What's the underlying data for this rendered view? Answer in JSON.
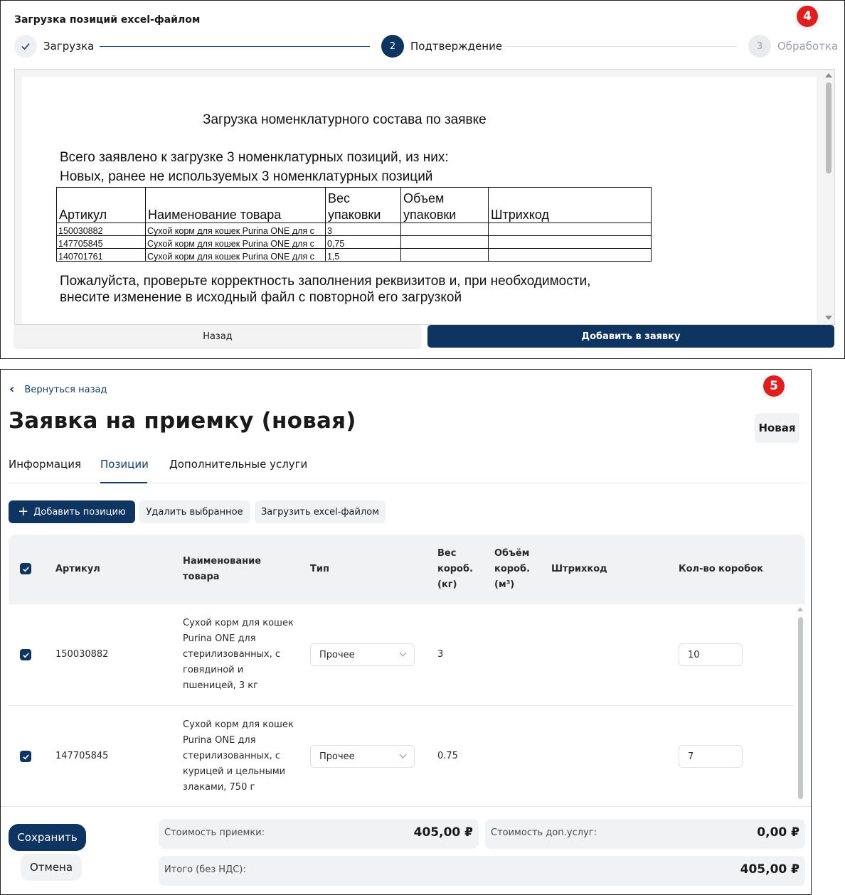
{
  "panel4": {
    "badge": "4",
    "title": "Загрузка позиций excel-файлом",
    "steps": [
      {
        "number": "✓",
        "label": "Загрузка"
      },
      {
        "number": "2",
        "label": "Подтверждение"
      },
      {
        "number": "3",
        "label": "Обработка"
      }
    ],
    "document": {
      "heading": "Загрузка номенклатурного состава по заявке",
      "line1": "Всего заявлено к загрузке 3 номенклатурных позиций, из них:",
      "line2": "Новых, ранее не используемых 3 номенклатурных позиций",
      "headers": [
        "Артикул",
        "Наименование товара",
        "Вес упаковки",
        "Объем упаковки",
        "Штрихкод"
      ],
      "headers_split": {
        "weight_1": "Вес",
        "weight_2": "упаковки",
        "volume_1": "Объем",
        "volume_2": "упаковки"
      },
      "rows": [
        {
          "article": "150030882",
          "name": "Сухой корм для кошек Purina ONE для с",
          "weight": "3",
          "volume": "",
          "barcode": ""
        },
        {
          "article": "147705845",
          "name": "Сухой корм для кошек Purina ONE для с",
          "weight": "0,75",
          "volume": "",
          "barcode": ""
        },
        {
          "article": "140701761",
          "name": "Сухой корм для кошек Purina ONE для с",
          "weight": "1,5",
          "volume": "",
          "barcode": ""
        }
      ],
      "note1": "Пожалуйста, проверьте корректность заполнения реквизитов и, при необходимости,",
      "note2": "внесите изменение в исходный файл с повторной его загрузкой"
    },
    "back_label": "Назад",
    "add_label": "Добавить в заявку"
  },
  "panel5": {
    "badge": "5",
    "back_link": "Вернуться назад",
    "title": "Заявка на приемку (новая)",
    "status": "Новая",
    "tabs": [
      "Информация",
      "Позиции",
      "Дополнительные услуги"
    ],
    "toolbar": {
      "add": "Добавить позицию",
      "delete": "Удалить выбранное",
      "upload": "Загрузить excel-файлом"
    },
    "columns": {
      "article": "Артикул",
      "name_1": "Наименование",
      "name_2": "товара",
      "type": "Тип",
      "weight_1": "Вес",
      "weight_2": "короб.",
      "weight_3": "(кг)",
      "volume_1": "Объём",
      "volume_2": "короб.",
      "volume_3": "(м³)",
      "barcode": "Штрихкод",
      "boxes": "Кол-во коробок"
    },
    "rows": [
      {
        "article": "150030882",
        "name_lines": [
          "Сухой корм для кошек",
          "Purina ONE для",
          "стерилизованных, с",
          "говядиной и",
          "пшеницей, 3 кг"
        ],
        "type": "Прочее",
        "weight": "3",
        "volume": "",
        "barcode": "",
        "boxes": "10"
      },
      {
        "article": "147705845",
        "name_lines": [
          "Сухой корм для кошек",
          "Purina ONE для",
          "стерилизованных, с",
          "курицей и цельными",
          "злаками, 750 г"
        ],
        "type": "Прочее",
        "weight": "0.75",
        "volume": "",
        "barcode": "",
        "boxes": "7"
      }
    ],
    "footer": {
      "save": "Сохранить",
      "cancel": "Отмена",
      "reception_cost_label": "Стоимость приемки:",
      "reception_cost_value": "405,00 ₽",
      "services_cost_label": "Стоимость доп.услуг:",
      "services_cost_value": "0,00 ₽",
      "total_label": "Итого (без НДС):",
      "total_value": "405,00 ₽"
    }
  },
  "colors": {
    "primary": "#0e3462",
    "badge": "#e01e1e",
    "muted_bg": "#f1f2f4",
    "link": "#123e6d"
  }
}
